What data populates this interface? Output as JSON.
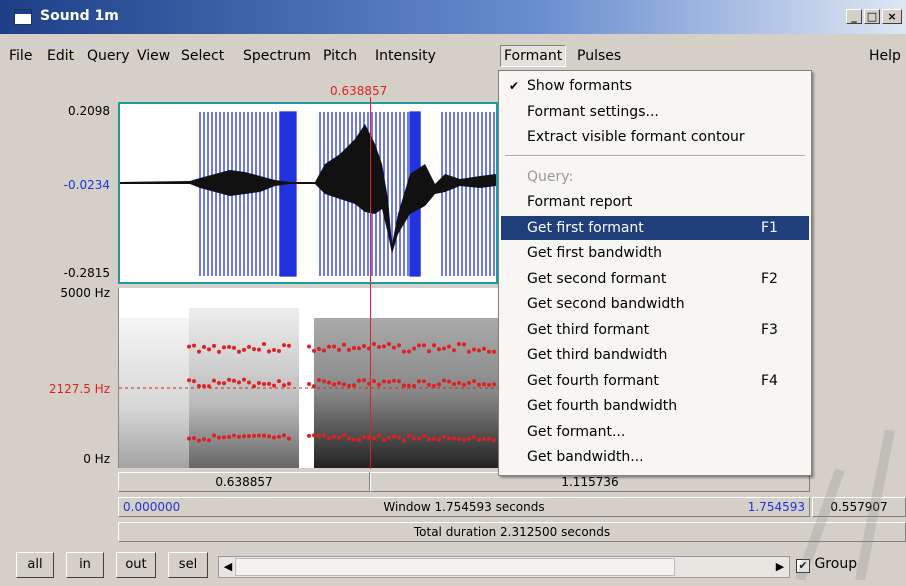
{
  "window": {
    "title": "Sound 1m",
    "controls": [
      "_",
      "□",
      "×"
    ]
  },
  "menubar": {
    "items": [
      "File",
      "Edit",
      "Query",
      "View",
      "Select",
      "Spectrum",
      "Pitch",
      "Intensity",
      "Formant",
      "Pulses"
    ],
    "help": "Help",
    "active": "Formant"
  },
  "plot": {
    "cursor_time": "0.638857",
    "wave_top": "0.2098",
    "wave_mid": "-0.0234",
    "wave_bottom": "-0.2815",
    "spec_top": "5000 Hz",
    "spec_mid": "2127.5 Hz",
    "spec_bottom": "0 Hz"
  },
  "strips": {
    "row1_left": "0.638857",
    "row1_right": "1.115736",
    "row2_start": "0.000000",
    "row2_window": "Window 1.754593 seconds",
    "row2_end": "1.754593",
    "row2_extra": "0.557907",
    "row3": "Total duration 2.312500 seconds"
  },
  "formant_menu": {
    "items": [
      {
        "label": "Show formants",
        "checked": true
      },
      {
        "label": "Formant settings..."
      },
      {
        "label": "Extract visible formant contour"
      },
      {
        "separator": true
      },
      {
        "label": "Query:",
        "disabled": true
      },
      {
        "label": "Formant report"
      },
      {
        "label": "Get first formant",
        "shortcut": "F1",
        "selected": true
      },
      {
        "label": "Get first bandwidth"
      },
      {
        "label": "Get second formant",
        "shortcut": "F2"
      },
      {
        "label": "Get second bandwidth"
      },
      {
        "label": "Get third formant",
        "shortcut": "F3"
      },
      {
        "label": "Get third bandwidth"
      },
      {
        "label": "Get fourth formant",
        "shortcut": "F4"
      },
      {
        "label": "Get fourth bandwidth"
      },
      {
        "label": "Get formant..."
      },
      {
        "label": "Get bandwidth..."
      }
    ]
  },
  "bottom": {
    "buttons": [
      "all",
      "in",
      "out",
      "sel"
    ],
    "group_label": "Group",
    "group_checked": true
  },
  "colors": {
    "selection": "#1f3f7a",
    "cursor": "#dd2222",
    "formant_dots": "#e02020",
    "wave_border": "#1a9ca0",
    "accent_blue": "#2233dd"
  }
}
